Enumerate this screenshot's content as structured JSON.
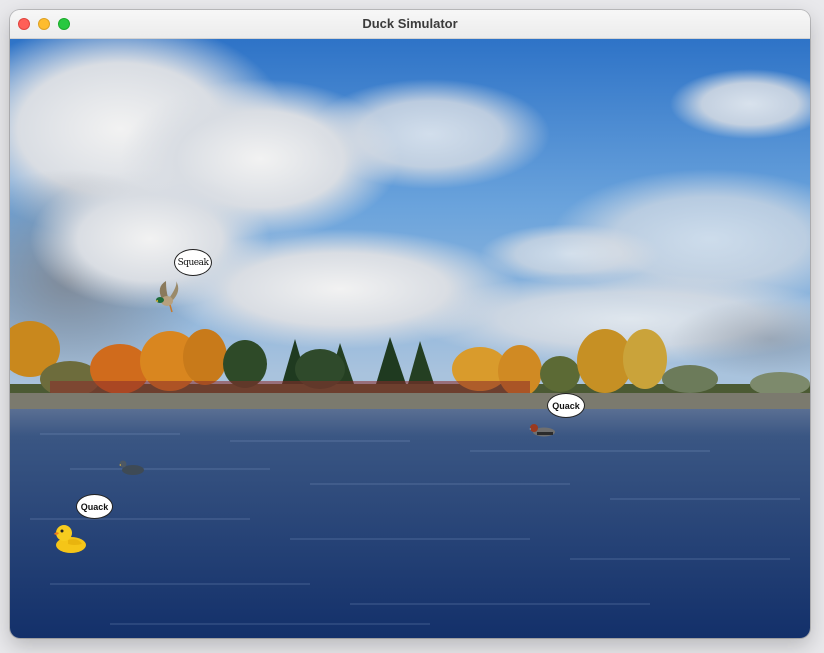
{
  "window": {
    "title": "Duck Simulator",
    "controls": [
      "close",
      "minimize",
      "zoom"
    ]
  },
  "colors": {
    "sky_top": "#2f74c8",
    "sky_bottom": "#8fb7e0",
    "water": "#1f3c6e",
    "close": "#ff5f57",
    "minimize": "#febc2e",
    "zoom": "#28c840"
  },
  "ducks": [
    {
      "kind": "mallard-duck",
      "state": "flying",
      "sound": "Squeak"
    },
    {
      "kind": "redhead-duck",
      "state": "floating",
      "sound": "Quack"
    },
    {
      "kind": "decoy-duck",
      "state": "floating",
      "sound": ""
    },
    {
      "kind": "rubber-duck",
      "state": "floating",
      "sound": "Quack"
    }
  ]
}
